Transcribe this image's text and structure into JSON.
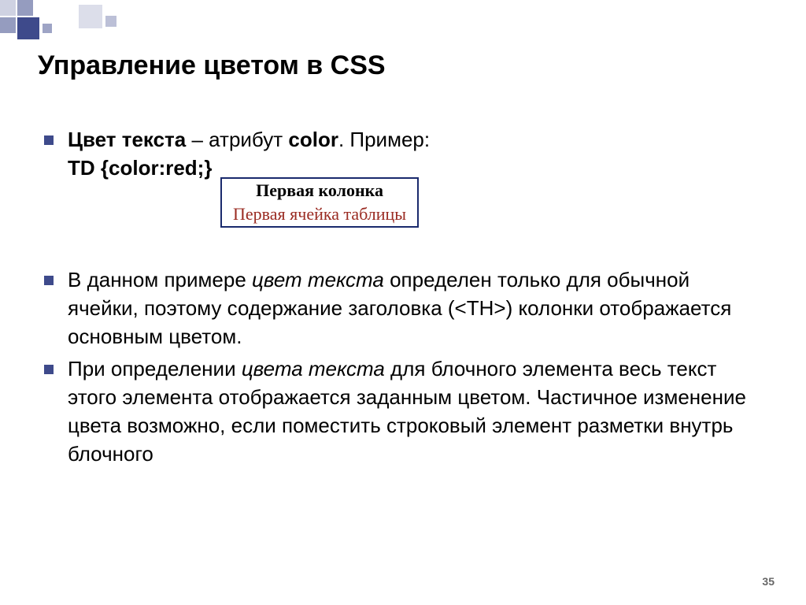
{
  "title": "Управление цветом в CSS",
  "bullets": {
    "b1": {
      "lead_bold": "Цвет текста",
      "dash": " – атрибут ",
      "attr_bold": "color",
      "after_attr": ". Пример:",
      "code_line": "TD {color:red;}"
    },
    "b2": {
      "pre": "В данном примере ",
      "em": "цвет текста",
      "post": " определен только для обычной ячейки, поэтому содержание заголовка (<TH>) колонки отображается основным цветом."
    },
    "b3": {
      "pre": "При определении ",
      "em": "цвета текста",
      "post": " для блочного элемента весь текст этого элемента отображается заданным цветом. Частичное изменение цвета возможно, если поместить строковый элемент разметки внутрь блочного"
    }
  },
  "table_example": {
    "header": "Первая колонка",
    "cell": "Первая ячейка таблицы"
  },
  "page_number": "35"
}
